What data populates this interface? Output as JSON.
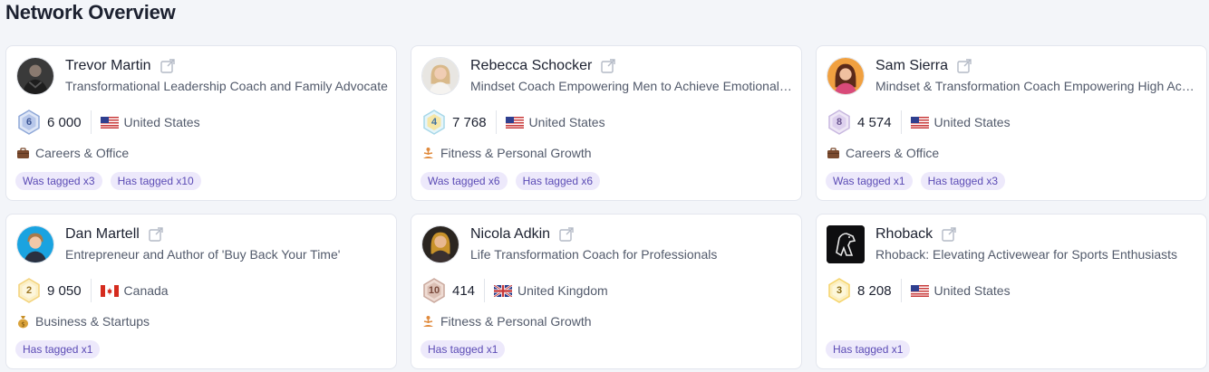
{
  "page": {
    "title": "Network Overview"
  },
  "cards": [
    {
      "name": "Trevor Martin",
      "bio": "Transformational Leadership Coach and Family Advocate",
      "level": "6",
      "followers": "6 000",
      "country": "United States",
      "flag": "us",
      "category": "Careers & Office",
      "category_icon": "briefcase-icon",
      "tags": [
        "Was tagged x3",
        "Has tagged x10"
      ],
      "badge_color": "#8fa8d8"
    },
    {
      "name": "Rebecca Schocker",
      "bio": "Mindset Coach Empowering Men to Achieve Emotional Mastery",
      "level": "4",
      "followers": "7 768",
      "country": "United States",
      "flag": "us",
      "category": "Fitness & Personal Growth",
      "category_icon": "meditation-icon",
      "tags": [
        "Was tagged x6",
        "Has tagged x6"
      ],
      "badge_color": "#a8d8e8"
    },
    {
      "name": "Sam Sierra",
      "bio": "Mindset & Transformation Coach Empowering High Achievers",
      "level": "8",
      "followers": "4 574",
      "country": "United States",
      "flag": "us",
      "category": "Careers & Office",
      "category_icon": "briefcase-icon",
      "tags": [
        "Was tagged x1",
        "Has tagged x3"
      ],
      "badge_color": "#c8b8e0"
    },
    {
      "name": "Dan Martell",
      "bio": "Entrepreneur and Author of 'Buy Back Your Time'",
      "level": "2",
      "followers": "9 050",
      "country": "Canada",
      "flag": "ca",
      "category": "Business & Startups",
      "category_icon": "money-bag-icon",
      "tags": [
        "Has tagged x1"
      ],
      "badge_color": "#f3d27a"
    },
    {
      "name": "Nicola Adkin",
      "bio": "Life Transformation Coach for Professionals",
      "level": "10",
      "followers": "414",
      "country": "United Kingdom",
      "flag": "gb",
      "category": "Fitness & Personal Growth",
      "category_icon": "meditation-icon",
      "tags": [
        "Has tagged x1"
      ],
      "badge_color": "#c9a79c"
    },
    {
      "name": "Rhoback",
      "bio": "Rhoback: Elevating Activewear for Sports Enthusiasts",
      "level": "3",
      "followers": "8 208",
      "country": "United States",
      "flag": "us",
      "category": "",
      "category_icon": "",
      "tags": [
        "Has tagged x1"
      ],
      "badge_color": "#f5d46a"
    }
  ]
}
